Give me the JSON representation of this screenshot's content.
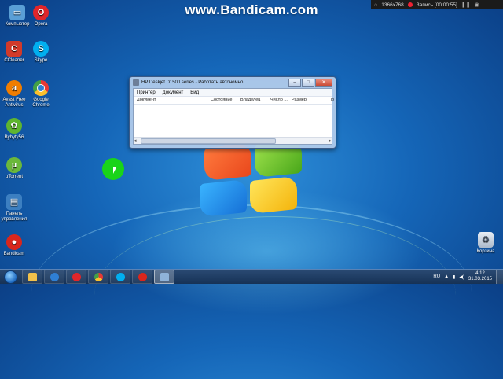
{
  "watermark": "www.Bandicam.com",
  "recording": {
    "resolution": "1366x768",
    "status": "Запись [00:00:55]"
  },
  "desktop_icons": [
    {
      "label": "Компьютер",
      "icon": "computer-icon",
      "color": "#5a9fd6"
    },
    {
      "label": "Opera",
      "icon": "opera-icon",
      "color": "#e0262b"
    },
    {
      "label": "CCleaner",
      "icon": "ccleaner-icon",
      "color": "#d23a2a"
    },
    {
      "label": "Skype",
      "icon": "skype-icon",
      "color": "#00aff0"
    },
    {
      "label": "Avast Free Antivirus",
      "icon": "avast-icon",
      "color": "#f07d00"
    },
    {
      "label": "Google Chrome",
      "icon": "chrome-icon",
      "color": "#4caf50"
    },
    {
      "label": "Bybyty56",
      "icon": "bybyty-icon",
      "color": "#5fb52f"
    },
    {
      "label": "uTorrent",
      "icon": "utorrent-icon",
      "color": "#6bb83b"
    },
    {
      "label": "Панель управления",
      "icon": "control-panel-icon",
      "color": "#3c7fc1"
    },
    {
      "label": "Bandicam",
      "icon": "bandicam-icon",
      "color": "#d9261c"
    }
  ],
  "window": {
    "title": "HP Deskjet D1500 series  -  Работать автономно",
    "menu": [
      "Принтер",
      "Документ",
      "Вид"
    ],
    "columns": [
      "Документ",
      "Состояние",
      "Владелец",
      "Число ...",
      "Размер",
      "По"
    ]
  },
  "recycle_bin": {
    "label": "Корзина"
  },
  "taskbar": {
    "apps": [
      {
        "name": "explorer-icon",
        "color": "#f2c14a"
      },
      {
        "name": "media-player-icon",
        "color": "#2f7fd4"
      },
      {
        "name": "opera-icon",
        "color": "#e0262b"
      },
      {
        "name": "chrome-icon",
        "color": "#4caf50"
      },
      {
        "name": "skype-icon",
        "color": "#00aff0"
      },
      {
        "name": "bandicam-icon",
        "color": "#d9261c"
      },
      {
        "name": "devices-printers-icon",
        "color": "#8fb3d9"
      }
    ],
    "language": "RU",
    "time": "4:12",
    "date": "31.03.2015"
  }
}
